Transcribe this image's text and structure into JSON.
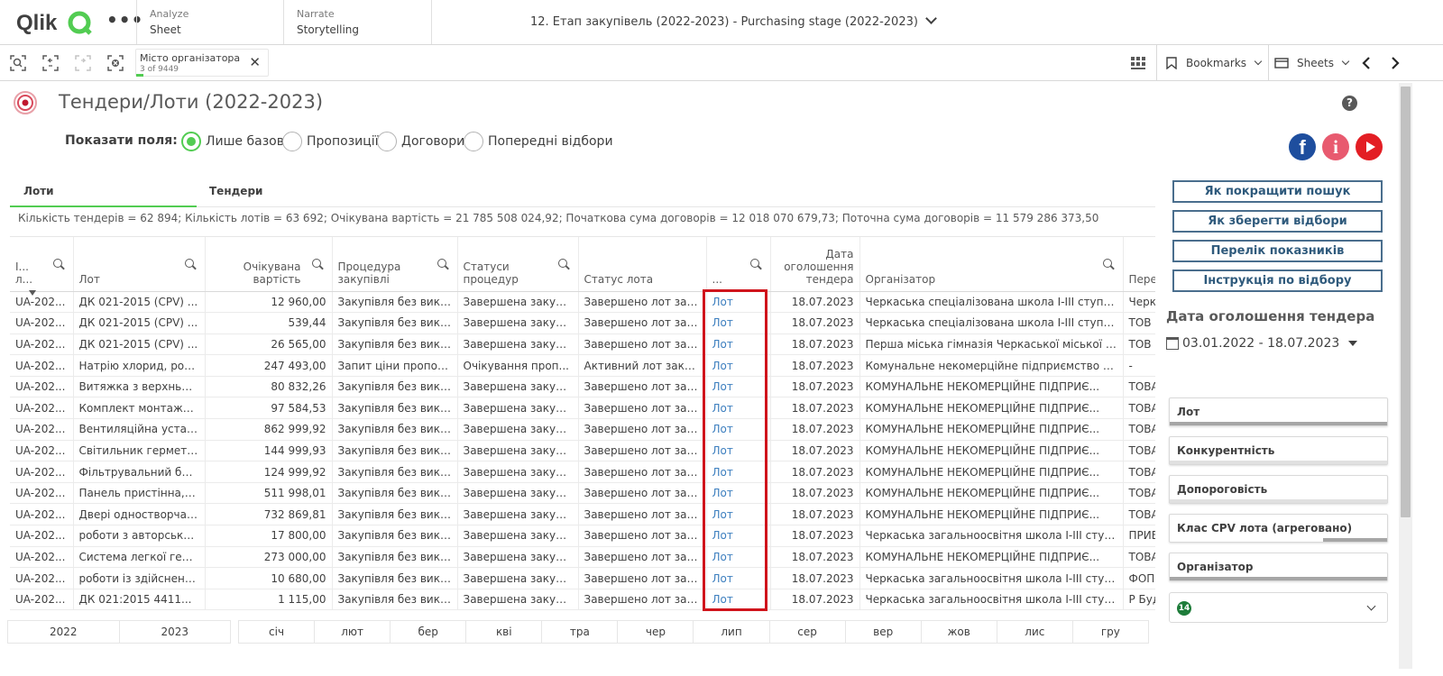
{
  "navbar": {
    "logo_text": "Qlik",
    "menu_dots": "•••",
    "analyze_label": "Analyze",
    "analyze_value": "Sheet",
    "narrate_label": "Narrate",
    "narrate_value": "Storytelling",
    "app_title": "12. Етап закупівель (2022-2023) - Purchasing stage (2022-2023)"
  },
  "toolbar": {
    "selection_field": "Місто організатора",
    "selection_count": "3 of 9449",
    "bookmarks_label": "Bookmarks",
    "sheets_label": "Sheets"
  },
  "sheet": {
    "title": "Тендери/Лоти (2022-2023)",
    "help": "?"
  },
  "show_fields": {
    "label": "Показати поля:",
    "options": [
      {
        "label": "Лише базові",
        "selected": true
      },
      {
        "label": "Пропозиції",
        "selected": false
      },
      {
        "label": "Договори",
        "selected": false
      },
      {
        "label": "Попередні відбори",
        "selected": false
      }
    ]
  },
  "social": {
    "facebook": "f",
    "info": "i"
  },
  "tabs": [
    {
      "label": "Лоти",
      "active": true
    },
    {
      "label": "Тендери",
      "active": false
    }
  ],
  "summary": "Кількість тендерів = 62 894; Кількість лотів = 63 692; Очікувана вартість = 21 785 508 024,92; Початкова сума договорів = 12 018 070 679,73; Поточна сума договорів = 11 579 286 373,50",
  "table": {
    "headers": [
      "І... л...",
      "Лот",
      "Очікувана вартість",
      "Процедура закупівлі",
      "Статуси процедур",
      "Статус лота",
      "...",
      "Дата оголошення тендера",
      "Організатор",
      "Перем"
    ],
    "rows": [
      [
        "UA-202...",
        "ДК 021-2015 (CPV) ...",
        "12 960,00",
        "Закупівля без вико...",
        "Завершена закупі...",
        "Завершено лот зак...",
        "Лот",
        "18.07.2023",
        "Черкаська спеціалізована школа І-ІІІ ступен...",
        "Черка"
      ],
      [
        "UA-202...",
        "ДК 021-2015 (CPV) ...",
        "539,44",
        "Закупівля без вико...",
        "Завершена закупі...",
        "Завершено лот зак...",
        "Лот",
        "18.07.2023",
        "Черкаська спеціалізована школа І-ІІІ ступен...",
        "ТОВ \""
      ],
      [
        "UA-202...",
        "ДК 021-2015 (CPV) ...",
        "26 565,00",
        "Закупівля без вико...",
        "Завершена закупі...",
        "Завершено лот зак...",
        "Лот",
        "18.07.2023",
        "Перша міська гімназія Черкаської міської ра...",
        "ТОВ \""
      ],
      [
        "UA-202...",
        "Натрію хлорид, роз...",
        "247 493,00",
        "Запит ціни пропоз...",
        "Очікування проп...",
        "Активний лот закуп...",
        "Лот",
        "18.07.2023",
        "Комунальне некомерційне підприємство \"Ч...",
        "-"
      ],
      [
        "UA-202...",
        "Витяжка з верхньої ...",
        "80 832,26",
        "Закупівля без вико...",
        "Завершена закупі...",
        "Завершено лот зак...",
        "Лот",
        "18.07.2023",
        "КОМУНАЛЬНЕ НЕКОМЕРЦІЙНЕ ПІДПРИЄ...",
        "ТОВА"
      ],
      [
        "UA-202...",
        "Комплект монтажн...",
        "97 584,53",
        "Закупівля без вико...",
        "Завершена закупі...",
        "Завершено лот зак...",
        "Лот",
        "18.07.2023",
        "КОМУНАЛЬНЕ НЕКОМЕРЦІЙНЕ ПІДПРИЄ...",
        "ТОВА"
      ],
      [
        "UA-202...",
        "Вентиляційна устан...",
        "862 999,92",
        "Закупівля без вико...",
        "Завершена закупі...",
        "Завершено лот зак...",
        "Лот",
        "18.07.2023",
        "КОМУНАЛЬНЕ НЕКОМЕРЦІЙНЕ ПІДПРИЄ...",
        "ТОВА"
      ],
      [
        "UA-202...",
        "Світильник герметі...",
        "144 999,93",
        "Закупівля без вико...",
        "Завершена закупі...",
        "Завершено лот зак...",
        "Лот",
        "18.07.2023",
        "КОМУНАЛЬНЕ НЕКОМЕРЦІЙНЕ ПІДПРИЄ...",
        "ТОВА"
      ],
      [
        "UA-202...",
        "Фільтрувальний бло...",
        "124 999,92",
        "Закупівля без вико...",
        "Завершена закупі...",
        "Завершено лот зак...",
        "Лот",
        "18.07.2023",
        "КОМУНАЛЬНЕ НЕКОМЕРЦІЙНЕ ПІДПРИЄ...",
        "ТОВА"
      ],
      [
        "UA-202...",
        "Панель пристінна, с...",
        "511 998,01",
        "Закупівля без вико...",
        "Завершена закупі...",
        "Завершено лот зак...",
        "Лот",
        "18.07.2023",
        "КОМУНАЛЬНЕ НЕКОМЕРЦІЙНЕ ПІДПРИЄ...",
        "ТОВА"
      ],
      [
        "UA-202...",
        "Двері одностворчат...",
        "732 869,81",
        "Закупівля без вико...",
        "Завершена закупі...",
        "Завершено лот зак...",
        "Лот",
        "18.07.2023",
        "КОМУНАЛЬНЕ НЕКОМЕРЦІЙНЕ ПІДПРИЄ...",
        "ТОВА"
      ],
      [
        "UA-202...",
        "роботи з авторсько...",
        "17 800,00",
        "Закупівля без вико...",
        "Завершена закупі...",
        "Завершено лот зак...",
        "Лот",
        "18.07.2023",
        "Черкаська загальноосвітня школа І-ІІІ ступ...",
        "ПРИВ"
      ],
      [
        "UA-202...",
        "Система легкої гер...",
        "273 000,00",
        "Закупівля без вико...",
        "Завершена закупі...",
        "Завершено лот зак...",
        "Лот",
        "18.07.2023",
        "КОМУНАЛЬНЕ НЕКОМЕРЦІЙНЕ ПІДПРИЄ...",
        "ТОВА"
      ],
      [
        "UA-202...",
        "роботи із здійсненн...",
        "10 680,00",
        "Закупівля без вико...",
        "Завершена закупі...",
        "Завершено лот зак...",
        "Лот",
        "18.07.2023",
        "Черкаська загальноосвітня школа І-ІІІ ступ...",
        "ФОП"
      ],
      [
        "UA-202...",
        "ДК 021:2015 4411...",
        "1 115,00",
        "Закупівля без вико...",
        "Завершена закупі...",
        "Завершено лот зак...",
        "Лот",
        "18.07.2023",
        "Черкаська загальноосвітня школа І-ІІІ ступ...",
        "Р Буд"
      ]
    ]
  },
  "years": [
    "2022",
    "2023"
  ],
  "months": [
    "січ",
    "лют",
    "бер",
    "кві",
    "тра",
    "чер",
    "лип",
    "сер",
    "вер",
    "жов",
    "лис",
    "гру"
  ],
  "right_panel": {
    "buttons": [
      "Як покращити пошук",
      "Як зберегти відбори",
      "Перелік показників",
      "Інструкція по відбору"
    ],
    "date_heading": "Дата оголошення тендера",
    "date_range": "03.01.2022 - 18.07.2023",
    "filters": [
      "Лот",
      "Конкурентність",
      "Допороговість",
      "Клас CPV лота (агреговано)",
      "Організатор"
    ],
    "dropdown_badge": "14"
  },
  "colors": {
    "accent_green": "#52cc52",
    "highlight_red": "#d0141c",
    "button_blue": "#2f5a7c"
  }
}
